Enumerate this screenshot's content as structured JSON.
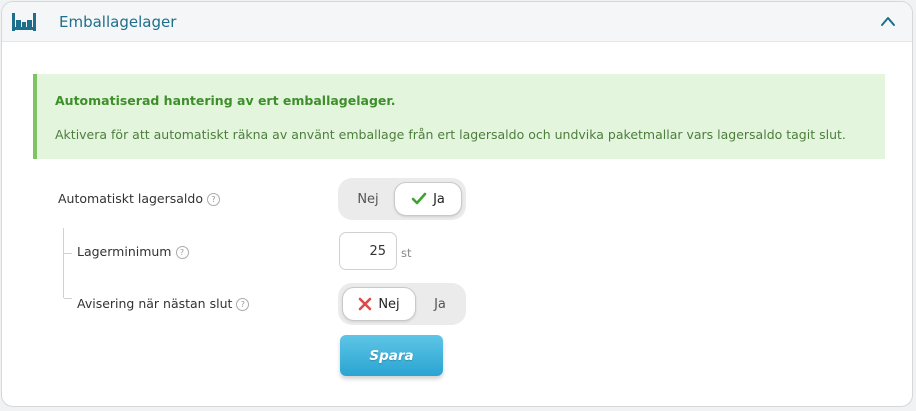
{
  "panel": {
    "title": "Emballagelager",
    "icon": "warehouse-shelf-icon",
    "collapse_icon": "chevron-up-icon"
  },
  "notice": {
    "heading": "Automatiserad hantering av ert emballagelager.",
    "body": "Aktivera för att automatiskt räkna av använt emballage från ert lagersaldo och undvika paketmallar vars lagersaldo tagit slut."
  },
  "settings": {
    "auto_stock": {
      "label": "Automatiskt lagersaldo",
      "options": [
        "Nej",
        "Ja"
      ],
      "selected": "Ja"
    },
    "min_stock": {
      "label": "Lagerminimum",
      "value": "25",
      "unit": "st"
    },
    "notify_low": {
      "label": "Avisering när nästan slut",
      "options": [
        "Nej",
        "Ja"
      ],
      "selected": "Nej"
    }
  },
  "actions": {
    "save_label": "Spara"
  },
  "help_glyph": "?",
  "colors": {
    "accent": "#1d6f8b",
    "success_bg": "#e4f5dd",
    "success_border": "#7ec561",
    "check": "#3aa52b",
    "cross": "#e04848",
    "button": "#2aa4d2"
  }
}
